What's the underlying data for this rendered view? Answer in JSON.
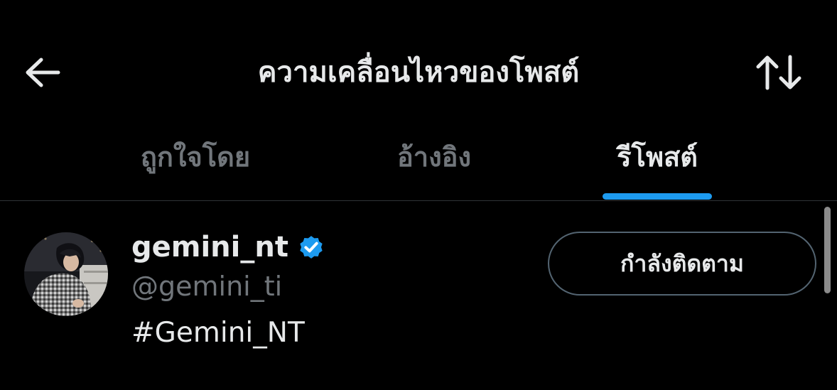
{
  "header": {
    "title": "ความเคลื่อนไหวของโพสต์",
    "back_icon": "arrow-left-icon",
    "sort_icon": "sort-arrows-icon"
  },
  "tabs": [
    {
      "label": "ถูกใจโดย",
      "active": false
    },
    {
      "label": "อ้างอิง",
      "active": false
    },
    {
      "label": "รีโพสต์",
      "active": true
    }
  ],
  "user": {
    "display_name": "gemini_nt",
    "handle": "@gemini_ti",
    "bio": "#Gemini_NT",
    "verified": true,
    "follow_button_label": "กำลังติดตาม"
  },
  "colors": {
    "background": "#000000",
    "text_primary": "#e7e9ea",
    "text_secondary": "#71767b",
    "accent": "#1d9bf0",
    "divider": "#2f3336"
  }
}
